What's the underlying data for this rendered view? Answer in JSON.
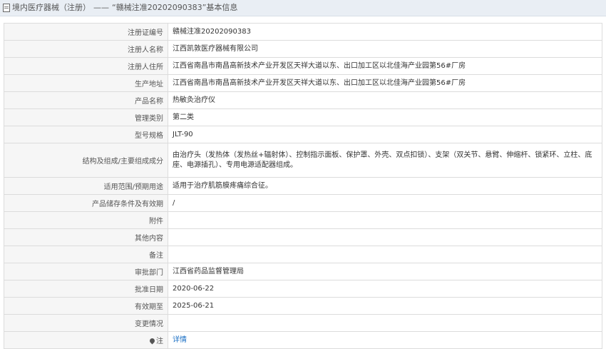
{
  "header": {
    "section": "境内医疗器械（注册）",
    "separator": "——",
    "record": "“赣械注准20202090383”",
    "suffix": "基本信息"
  },
  "rows": [
    {
      "label": "注册证编号",
      "value": "赣械注准20202090383"
    },
    {
      "label": "注册人名称",
      "value": "江西凯敦医疗器械有限公司"
    },
    {
      "label": "注册人住所",
      "value": "江西省南昌市南昌高新技术产业开发区天祥大道以东、出口加工区以北佳海产业园第56#厂房"
    },
    {
      "label": "生产地址",
      "value": "江西省南昌市南昌高新技术产业开发区天祥大道以东、出口加工区以北佳海产业园第56#厂房"
    },
    {
      "label": "产品名称",
      "value": "热敏灸治疗仪"
    },
    {
      "label": "管理类别",
      "value": "第二类"
    },
    {
      "label": "型号规格",
      "value": "JLT-90"
    },
    {
      "label": "结构及组成/主要组成成分",
      "value": "由治疗头（发热体（发热丝+辐射体）、控制指示面板、保护罩、外壳、双点扣锁）、支架（双关节、悬臂、伸缩杆、锁紧环、立柱、底座、电源插孔）、专用电源适配器组成。"
    },
    {
      "label": "适用范围/预期用途",
      "value": "适用于治疗肌筋膜疼痛综合征。"
    },
    {
      "label": "产品储存条件及有效期",
      "value": "/"
    },
    {
      "label": "附件",
      "value": ""
    },
    {
      "label": "其他内容",
      "value": ""
    },
    {
      "label": "备注",
      "value": ""
    },
    {
      "label": "审批部门",
      "value": "江西省药品监督管理局"
    },
    {
      "label": "批准日期",
      "value": "2020-06-22"
    },
    {
      "label": "有效期至",
      "value": "2025-06-21"
    },
    {
      "label": "变更情况",
      "value": ""
    }
  ],
  "note": {
    "label": "注",
    "link": "详情",
    "icon": "pin-icon"
  }
}
